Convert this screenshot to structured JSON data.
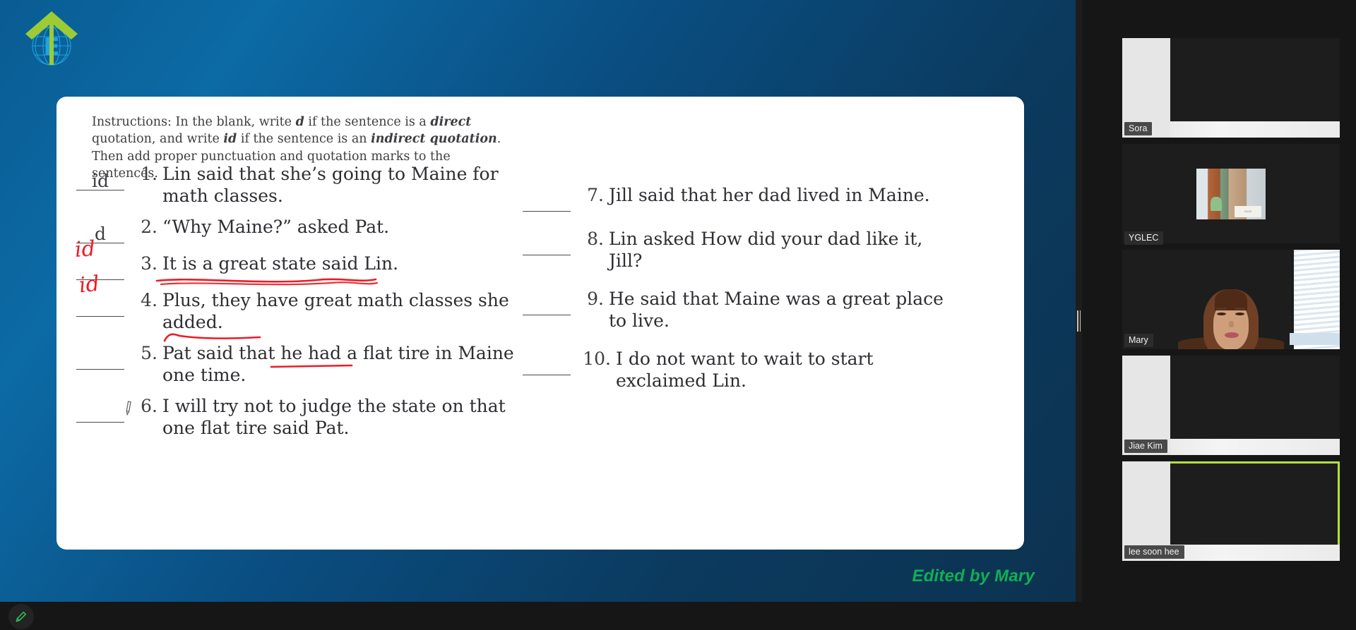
{
  "meeting": {
    "logo_alt": "green-arrow-globe-logo",
    "watermark": "Edited by Mary"
  },
  "slide": {
    "instructions": {
      "part1": "Instructions: In the blank, write ",
      "em1": "d",
      "part2": " if the sentence is a ",
      "em2": "direct",
      "part3": " quotation, and write ",
      "em3": "id",
      "part4": " if the sentence is an ",
      "em4": "indirect quotation",
      "part5": ". Then add proper punctuation and quotation marks to the sentences."
    },
    "left_column": [
      {
        "number": "1.",
        "answer": "id",
        "answer_type": "typed",
        "text": "Lin said that she’s going to Maine for math classes."
      },
      {
        "number": "2.",
        "answer": "d",
        "answer_type": "typed",
        "text": "“Why Maine?” asked Pat."
      },
      {
        "number": "3.",
        "answer": "id",
        "answer_type": "handwritten-red",
        "text": "It is a great state said Lin."
      },
      {
        "number": "4.",
        "answer": "id",
        "answer_type": "handwritten-red",
        "text": "Plus, they have great math classes she added."
      },
      {
        "number": "5.",
        "answer": "",
        "answer_type": "empty",
        "text": "Pat said that he had a flat tire in Maine one time."
      },
      {
        "number": "6.",
        "answer": "",
        "answer_type": "empty",
        "text": "I will try not to judge the state on that one flat tire said Pat."
      }
    ],
    "right_column": [
      {
        "number": "7.",
        "answer": "",
        "answer_type": "empty",
        "text": "Jill said that her dad lived in Maine."
      },
      {
        "number": "8.",
        "answer": "",
        "answer_type": "empty",
        "text": "Lin asked How did your dad like it, Jill?"
      },
      {
        "number": "9.",
        "answer": "",
        "answer_type": "empty",
        "text": "He said that Maine was a great place to live."
      },
      {
        "number": "10.",
        "answer": "",
        "answer_type": "empty",
        "text": "I do not want to wait to start exclaimed Lin."
      }
    ],
    "annotations": {
      "color": "#ee1b24",
      "underlines": [
        {
          "target": "item 3 - It is a great state said Lin."
        },
        {
          "target": "item 4 - classes she added"
        },
        {
          "target": "item 5 - flat tire"
        }
      ]
    }
  },
  "participants": [
    {
      "name": "Sora",
      "video": "blank",
      "active": false
    },
    {
      "name": "YGLEC",
      "video": "thumbnail",
      "active": false
    },
    {
      "name": "Mary",
      "video": "camera",
      "active": false
    },
    {
      "name": "Jiae Kim",
      "video": "blank",
      "active": false
    },
    {
      "name": "lee soon hee",
      "video": "blank",
      "active": true
    }
  ],
  "toolbar": {
    "pen_icon": "pencil-icon",
    "pen_color": "#2fbf5e"
  },
  "colors": {
    "slide_bg_start": "#0c6aa5",
    "slide_bg_end": "#0d3250",
    "annotation_red": "#ee1b24",
    "watermark_green": "#0fb055",
    "active_speaker": "#b5e03a"
  }
}
